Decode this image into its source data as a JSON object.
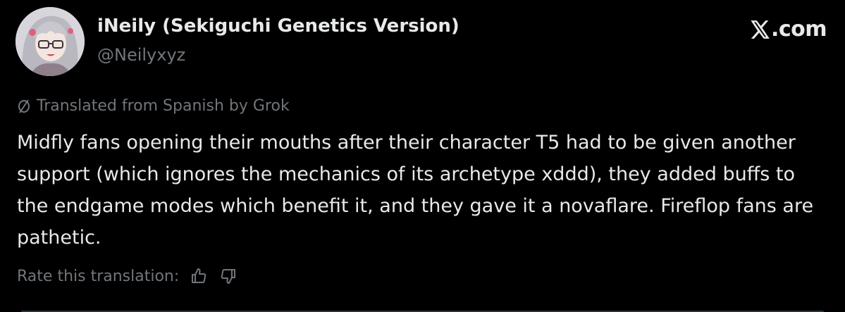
{
  "author": {
    "display_name": "iNeily (Sekiguchi Genetics Version)",
    "handle": "@Neilyxyz"
  },
  "brand": {
    "label": ".com"
  },
  "translation": {
    "notice": "Translated from Spanish by Grok",
    "icon": "no-translate-icon"
  },
  "post": {
    "text": "Midfly fans opening their mouths after their character T5 had to be given another support (which ignores the mechanics of its archetype xddd), they added buffs to the endgame modes which benefit it, and they gave it a novaflare. Fireflop fans are pathetic."
  },
  "rating": {
    "label": "Rate this translation:",
    "up_icon": "thumbs-up-icon",
    "down_icon": "thumbs-down-icon"
  },
  "colors": {
    "background": "#000000",
    "primary_text": "#e7e9ea",
    "secondary_text": "#71767b"
  }
}
